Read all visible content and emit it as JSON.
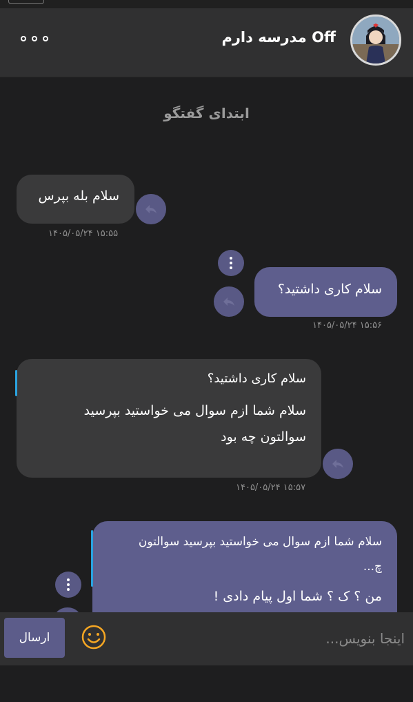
{
  "header": {
    "contact_name": "Off مدرسه دارم"
  },
  "chat": {
    "start_label": "ابتدای گفتگو",
    "messages": [
      {
        "direction": "in",
        "lines": [
          "سلام بله بپرس"
        ],
        "time": "۱۴۰۵/۰۵/۲۴ ۱۵:۵۵"
      },
      {
        "direction": "out",
        "lines": [
          "سلام کاری داشتید؟"
        ],
        "time": "۱۴۰۵/۰۵/۲۴ ۱۵:۵۶"
      },
      {
        "direction": "in",
        "quote": "سلام کاری داشتید؟",
        "lines": [
          "سلام شما ازم سوال می خواستید بپرسید",
          "سوالتون چه بود"
        ],
        "time": "۱۴۰۵/۰۵/۲۴ ۱۵:۵۷"
      },
      {
        "direction": "out",
        "quote_lines": [
          "سلام شما ازم سوال می خواستید بپرسید سوالتون",
          "چ..."
        ],
        "lines": [
          "من ؟ ک ؟ شما اول پیام دادی !"
        ]
      }
    ]
  },
  "composer": {
    "send_label": "ارسال",
    "placeholder": "اینجا بنویس..."
  },
  "colors": {
    "outgoing_bubble": "#5e5e8d",
    "incoming_bubble": "#3a3a3b",
    "quote_accent": "#2aa3e0",
    "emoji": "#f5a623"
  },
  "icons": [
    "more-icon",
    "reply-icon",
    "kebab-icon",
    "emoji-icon"
  ]
}
